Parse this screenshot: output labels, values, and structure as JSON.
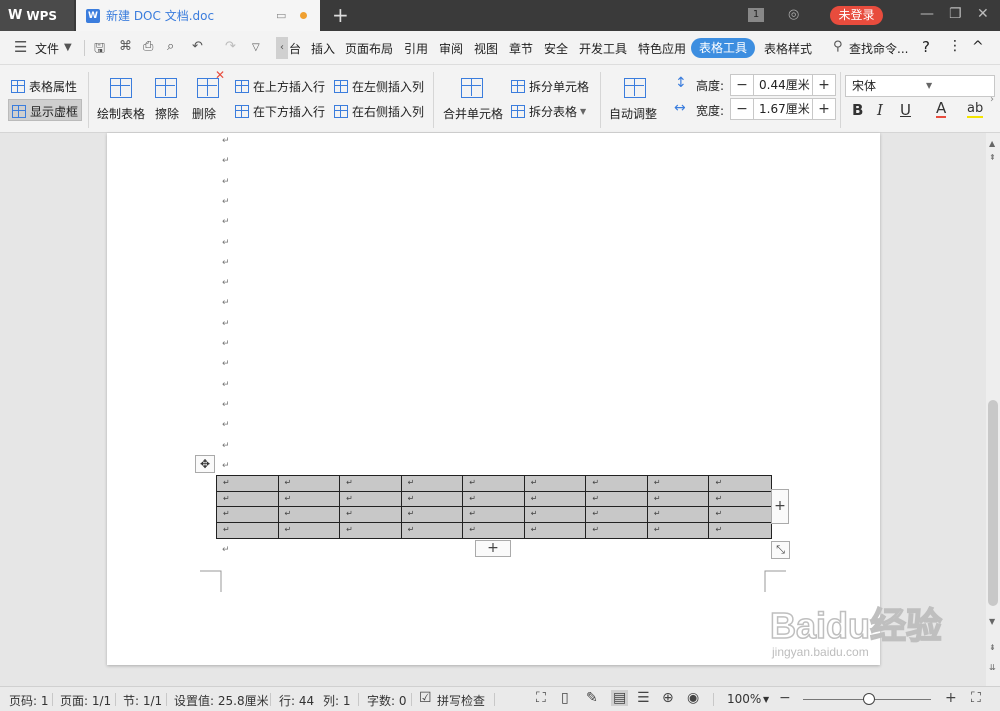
{
  "titlebar": {
    "app_name": "WPS",
    "doc_title": "新建 DOC 文档.doc",
    "new_tab": "+",
    "badge": "1",
    "login": "未登录",
    "minimize": "—",
    "restore": "❐",
    "close": "✕"
  },
  "menubar": {
    "file": "文件",
    "tabs": [
      "台",
      "插入",
      "页面布局",
      "引用",
      "审阅",
      "视图",
      "章节",
      "安全",
      "开发工具",
      "特色应用",
      "表格工具",
      "表格样式"
    ],
    "active_tab": "表格工具",
    "search": "查找命令...",
    "help": "?",
    "more": "⋮",
    "collapse": "^"
  },
  "ribbon": {
    "table_props": "表格属性",
    "show_gridlines": "显示虚框",
    "draw_table": "绘制表格",
    "erase": "擦除",
    "delete": "删除",
    "insert_row_above": "在上方插入行",
    "insert_row_below": "在下方插入行",
    "insert_col_left": "在左侧插入列",
    "insert_col_right": "在右侧插入列",
    "merge_cells": "合并单元格",
    "split_cells": "拆分单元格",
    "split_table": "拆分表格",
    "auto_fit": "自动调整",
    "height_label": "高度:",
    "height_value": "0.44厘米",
    "width_label": "宽度:",
    "width_value": "1.67厘米",
    "font_name": "宋体",
    "bold": "B",
    "italic": "I",
    "underline": "U",
    "font_color": "A",
    "highlight": "ab"
  },
  "document": {
    "para_mark": "↵",
    "table": {
      "rows": 4,
      "cols": 9
    }
  },
  "watermark": {
    "brand": "Baidu经验",
    "url": "jingyan.baidu.com"
  },
  "status": {
    "page_no": "页码: 1",
    "pages": "页面: 1/1",
    "section": "节: 1/1",
    "setting": "设置值: 25.8厘米",
    "row": "行: 44",
    "col": "列: 1",
    "words": "字数: 0",
    "spellcheck": "拼写检查",
    "zoom": "100%"
  },
  "colors": {
    "accent": "#3d8ee0",
    "login_red": "#e84c3d",
    "table_fill": "#c8c8c8"
  }
}
